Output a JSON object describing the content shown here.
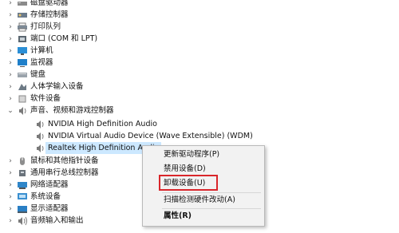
{
  "tree_items": [
    {
      "label": "磁盘驱动器",
      "icon": "disk-drive-icon",
      "expanded": false
    },
    {
      "label": "存储控制器",
      "icon": "storage-controller-icon",
      "expanded": false
    },
    {
      "label": "打印队列",
      "icon": "printer-icon",
      "expanded": false
    },
    {
      "label": "端口 (COM 和 LPT)",
      "icon": "port-icon",
      "expanded": false
    },
    {
      "label": "计算机",
      "icon": "computer-icon",
      "expanded": false
    },
    {
      "label": "监视器",
      "icon": "monitor-icon",
      "expanded": false
    },
    {
      "label": "键盘",
      "icon": "keyboard-icon",
      "expanded": false
    },
    {
      "label": "人体学输入设备",
      "icon": "hid-icon",
      "expanded": false
    },
    {
      "label": "软件设备",
      "icon": "software-device-icon",
      "expanded": false
    },
    {
      "label": "声音、视频和游戏控制器",
      "icon": "speaker-icon",
      "expanded": true
    },
    {
      "label": "NVIDIA High Definition Audio",
      "icon": "speaker-icon",
      "child": true
    },
    {
      "label": "NVIDIA Virtual Audio Device (Wave Extensible) (WDM)",
      "icon": "speaker-icon",
      "child": true
    },
    {
      "label": "Realtek High Definition Audio",
      "icon": "speaker-icon",
      "child": true,
      "selected": true
    },
    {
      "label": "鼠标和其他指针设备",
      "icon": "mouse-icon",
      "expanded": false
    },
    {
      "label": "通用串行总线控制器",
      "icon": "usb-icon",
      "expanded": false
    },
    {
      "label": "网络适配器",
      "icon": "network-adapter-icon",
      "expanded": false
    },
    {
      "label": "系统设备",
      "icon": "system-device-icon",
      "expanded": false
    },
    {
      "label": "显示适配器",
      "icon": "display-adapter-icon",
      "expanded": false
    },
    {
      "label": "音频输入和输出",
      "icon": "audio-io-icon",
      "expanded": false
    }
  ],
  "context_menu": {
    "items": [
      {
        "label": "更新驱动程序(P)"
      },
      {
        "label": "禁用设备(D)"
      },
      {
        "label": "卸载设备(U)",
        "highlighted": true
      },
      {
        "label": "扫描检测硬件改动(A)"
      },
      {
        "label": "属性(R)",
        "bold": true
      }
    ]
  },
  "colors": {
    "selection_background": "#cce8ff",
    "highlight_border": "#d9262b",
    "menu_background": "#f2f2f2"
  }
}
